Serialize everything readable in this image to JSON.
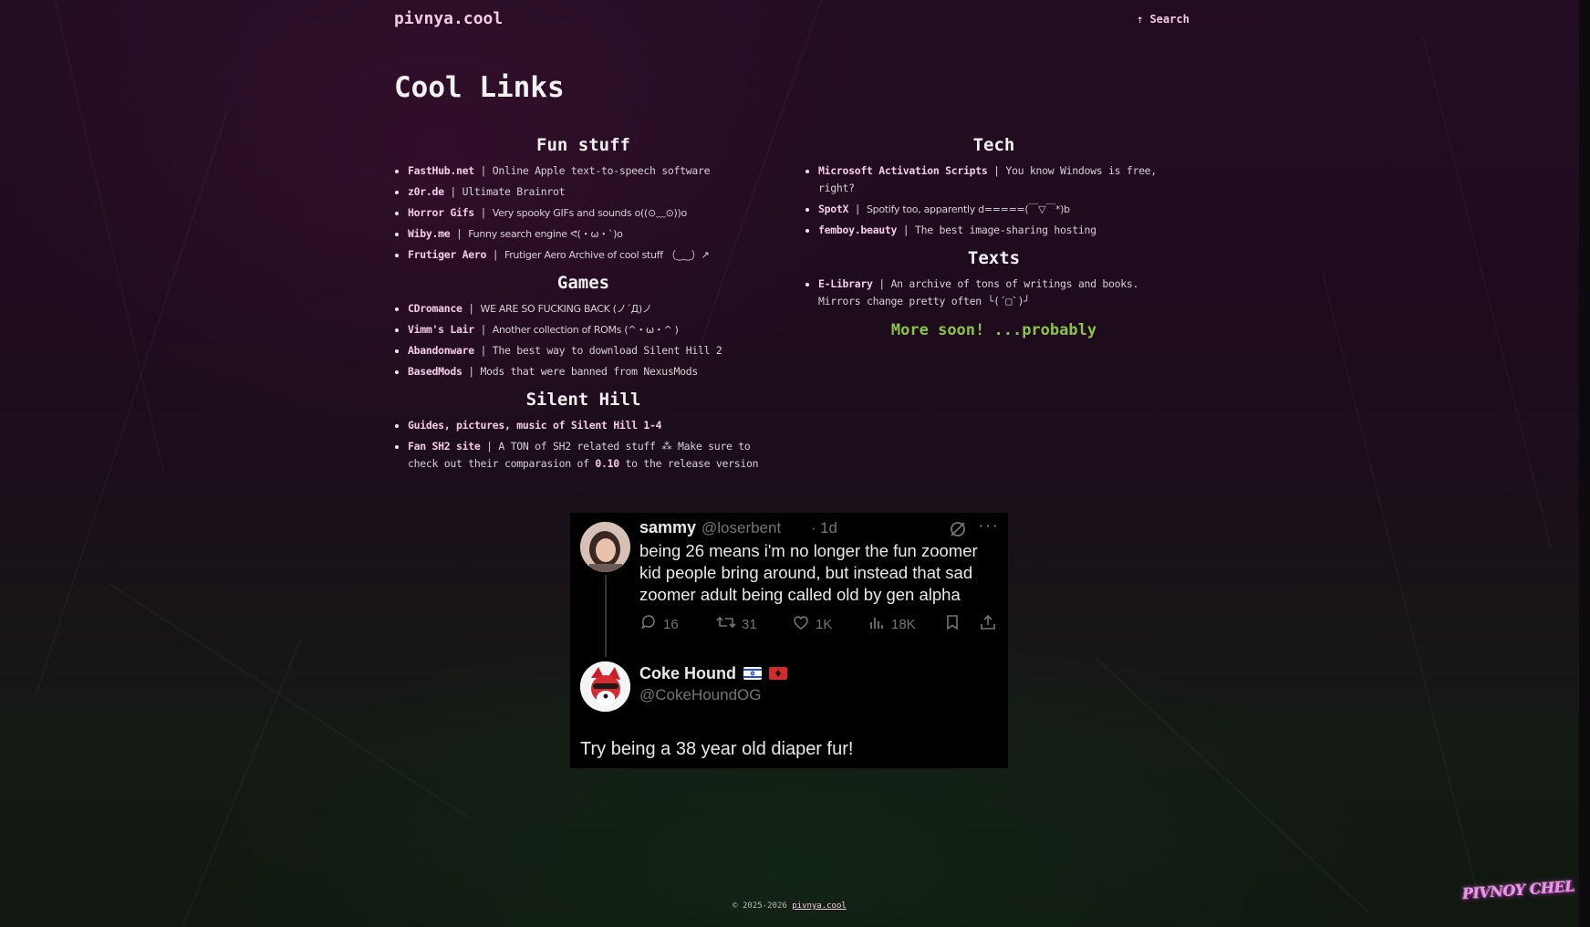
{
  "header": {
    "site_name": "pivnya.cool",
    "search_label": "⇡ Search"
  },
  "page_title": "Cool Links",
  "sections": {
    "fun": {
      "heading": "Fun stuff",
      "items": [
        {
          "name": "FastHub.net",
          "desc": "Online Apple text-to-speech software"
        },
        {
          "name": "z0r.de",
          "desc": "Ultimate Brainrot"
        },
        {
          "name": "Horror Gifs",
          "desc": "Very spooky GIFs and sounds o((⊙﹏⊙))o"
        },
        {
          "name": "Wiby.me",
          "desc": "Funny search engine ᕙ(・ω・`)o"
        },
        {
          "name": "Frutiger Aero",
          "desc": "Frutiger Aero Archive of cool stuff （‿‿）↗"
        }
      ]
    },
    "games": {
      "heading": "Games",
      "items": [
        {
          "name": "CDromance",
          "desc": "WE ARE SO FUCKING BACK (ノ´Д)ノ"
        },
        {
          "name": "Vimm's Lair",
          "desc": "Another collection of ROMs (^・ω・^ )"
        },
        {
          "name": "Abandonware",
          "desc": "The best way to download Silent Hill 2"
        },
        {
          "name": "BasedMods",
          "desc": "Mods that were banned from NexusMods"
        }
      ]
    },
    "silent_hill": {
      "heading": "Silent Hill",
      "item1": {
        "name": "Guides, pictures, music of Silent Hill 1-4"
      },
      "item2": {
        "name": "Fan SH2 site",
        "desc_a": "A TON of SH2 related stuff ⁂ Make sure to check out their comparasion of",
        "strong": "0.10",
        "desc_b": "to the release version"
      }
    },
    "tech": {
      "heading": "Tech",
      "items": [
        {
          "name": "Microsoft Activation Scripts",
          "desc": "You know Windows is free, right?"
        },
        {
          "name": "SpotX",
          "desc": "Spotify too, apparently d=====(￣▽￣*)b"
        },
        {
          "name": "femboy.beauty",
          "desc": "The best image-sharing hosting"
        }
      ]
    },
    "texts": {
      "heading": "Texts",
      "items": [
        {
          "name": "E-Library",
          "desc": "An archive of tons of writings and books. Mirrors change pretty often ╰(´□`)╯"
        }
      ]
    }
  },
  "more_soon": "More soon! ...probably",
  "tweet": {
    "author_name": "sammy",
    "author_handle": "@loserbent",
    "dot": "·",
    "time": "1d",
    "text": "being 26 means i'm no longer the fun zoomer kid people bring around, but instead that sad zoomer adult being called old by gen alpha",
    "replies": "16",
    "retweets": "31",
    "likes": "1K",
    "views": "18K",
    "reply_name": "Coke Hound",
    "reply_handle": "@CokeHoundOG",
    "reply_text": "Try being a 38 year old diaper fur!"
  },
  "footer": {
    "copyright": "© 2025-2026",
    "link": "pivnya.cool"
  },
  "corner_logo": "PIVNOY CHEL",
  "colors": {
    "accent_pink": "#f3cbe7",
    "green": "#8bc34a",
    "bg_top": "#230c22",
    "bg_bottom": "#101810"
  },
  "icons": [
    "reply-icon",
    "retweet-icon",
    "like-icon",
    "views-icon",
    "bookmark-icon",
    "share-icon",
    "grok-icon",
    "more-icon"
  ]
}
